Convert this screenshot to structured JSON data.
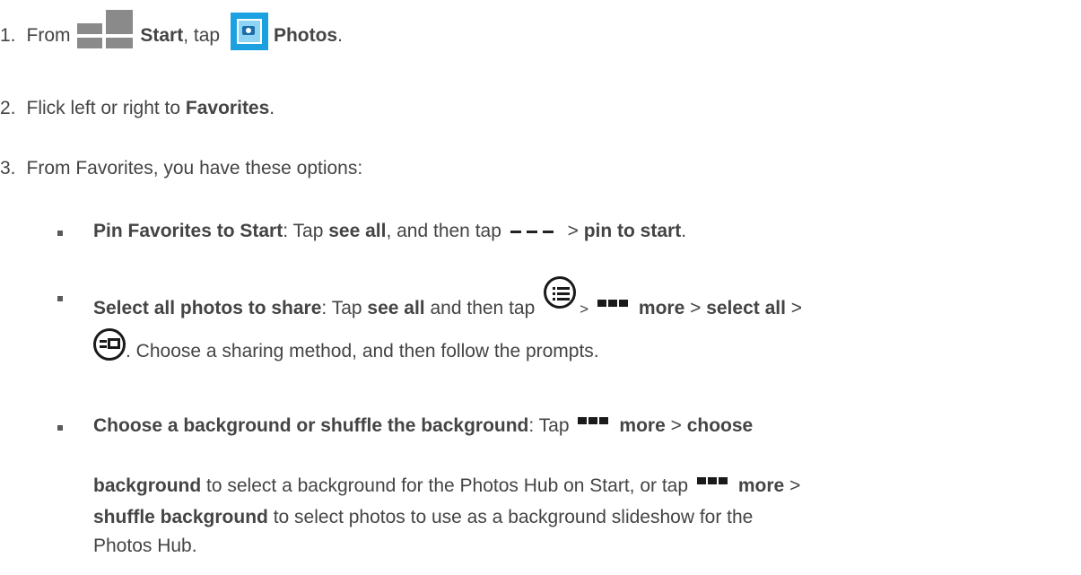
{
  "step1": {
    "number": "1.",
    "from": "From",
    "start": "Start",
    "tap": ", tap",
    "photos": "Photos",
    "end": "."
  },
  "step2": {
    "number": "2.",
    "text": "Flick left or right to",
    "favorites": "Favorites",
    "end": "."
  },
  "step3": {
    "number": "3.",
    "text": "From Favorites, you have these options:"
  },
  "options": {
    "pin": {
      "title": "Pin Favorites to Start",
      "t1": ": Tap",
      "see_all": "see all",
      "t2": ", and then tap",
      "gt": ">",
      "action": "pin to start",
      "end": "."
    },
    "select": {
      "title": "Select all photos to share",
      "t1": ": Tap",
      "see_all": "see all",
      "t2": "and then tap",
      "gt1": ">",
      "more": "more",
      "gt2": ">",
      "select_all": "select all",
      "gt3": ">",
      "line2": ". Choose a sharing method, and then follow the prompts."
    },
    "background": {
      "title": "Choose a background or shuffle the background",
      "t1": ": Tap",
      "more": "more",
      "gt1": ">",
      "choose": "choose",
      "background_word": "background",
      "t2": "to select a background for the Photos Hub on Start, or tap",
      "more2": "more",
      "gt2": ">",
      "shuffle": "shuffle background",
      "t3": "to select photos to use as a background slideshow for the",
      "t4": "Photos Hub."
    }
  },
  "icons": {
    "start": "windows-logo-icon",
    "photos": "photos-tile-icon",
    "app_bar": "dashes-icon",
    "select": "list-circle-icon",
    "more": "more-icon",
    "share": "share-circle-icon"
  },
  "colors": {
    "text": "#444444",
    "photos_tile": "#1ba1e2"
  }
}
